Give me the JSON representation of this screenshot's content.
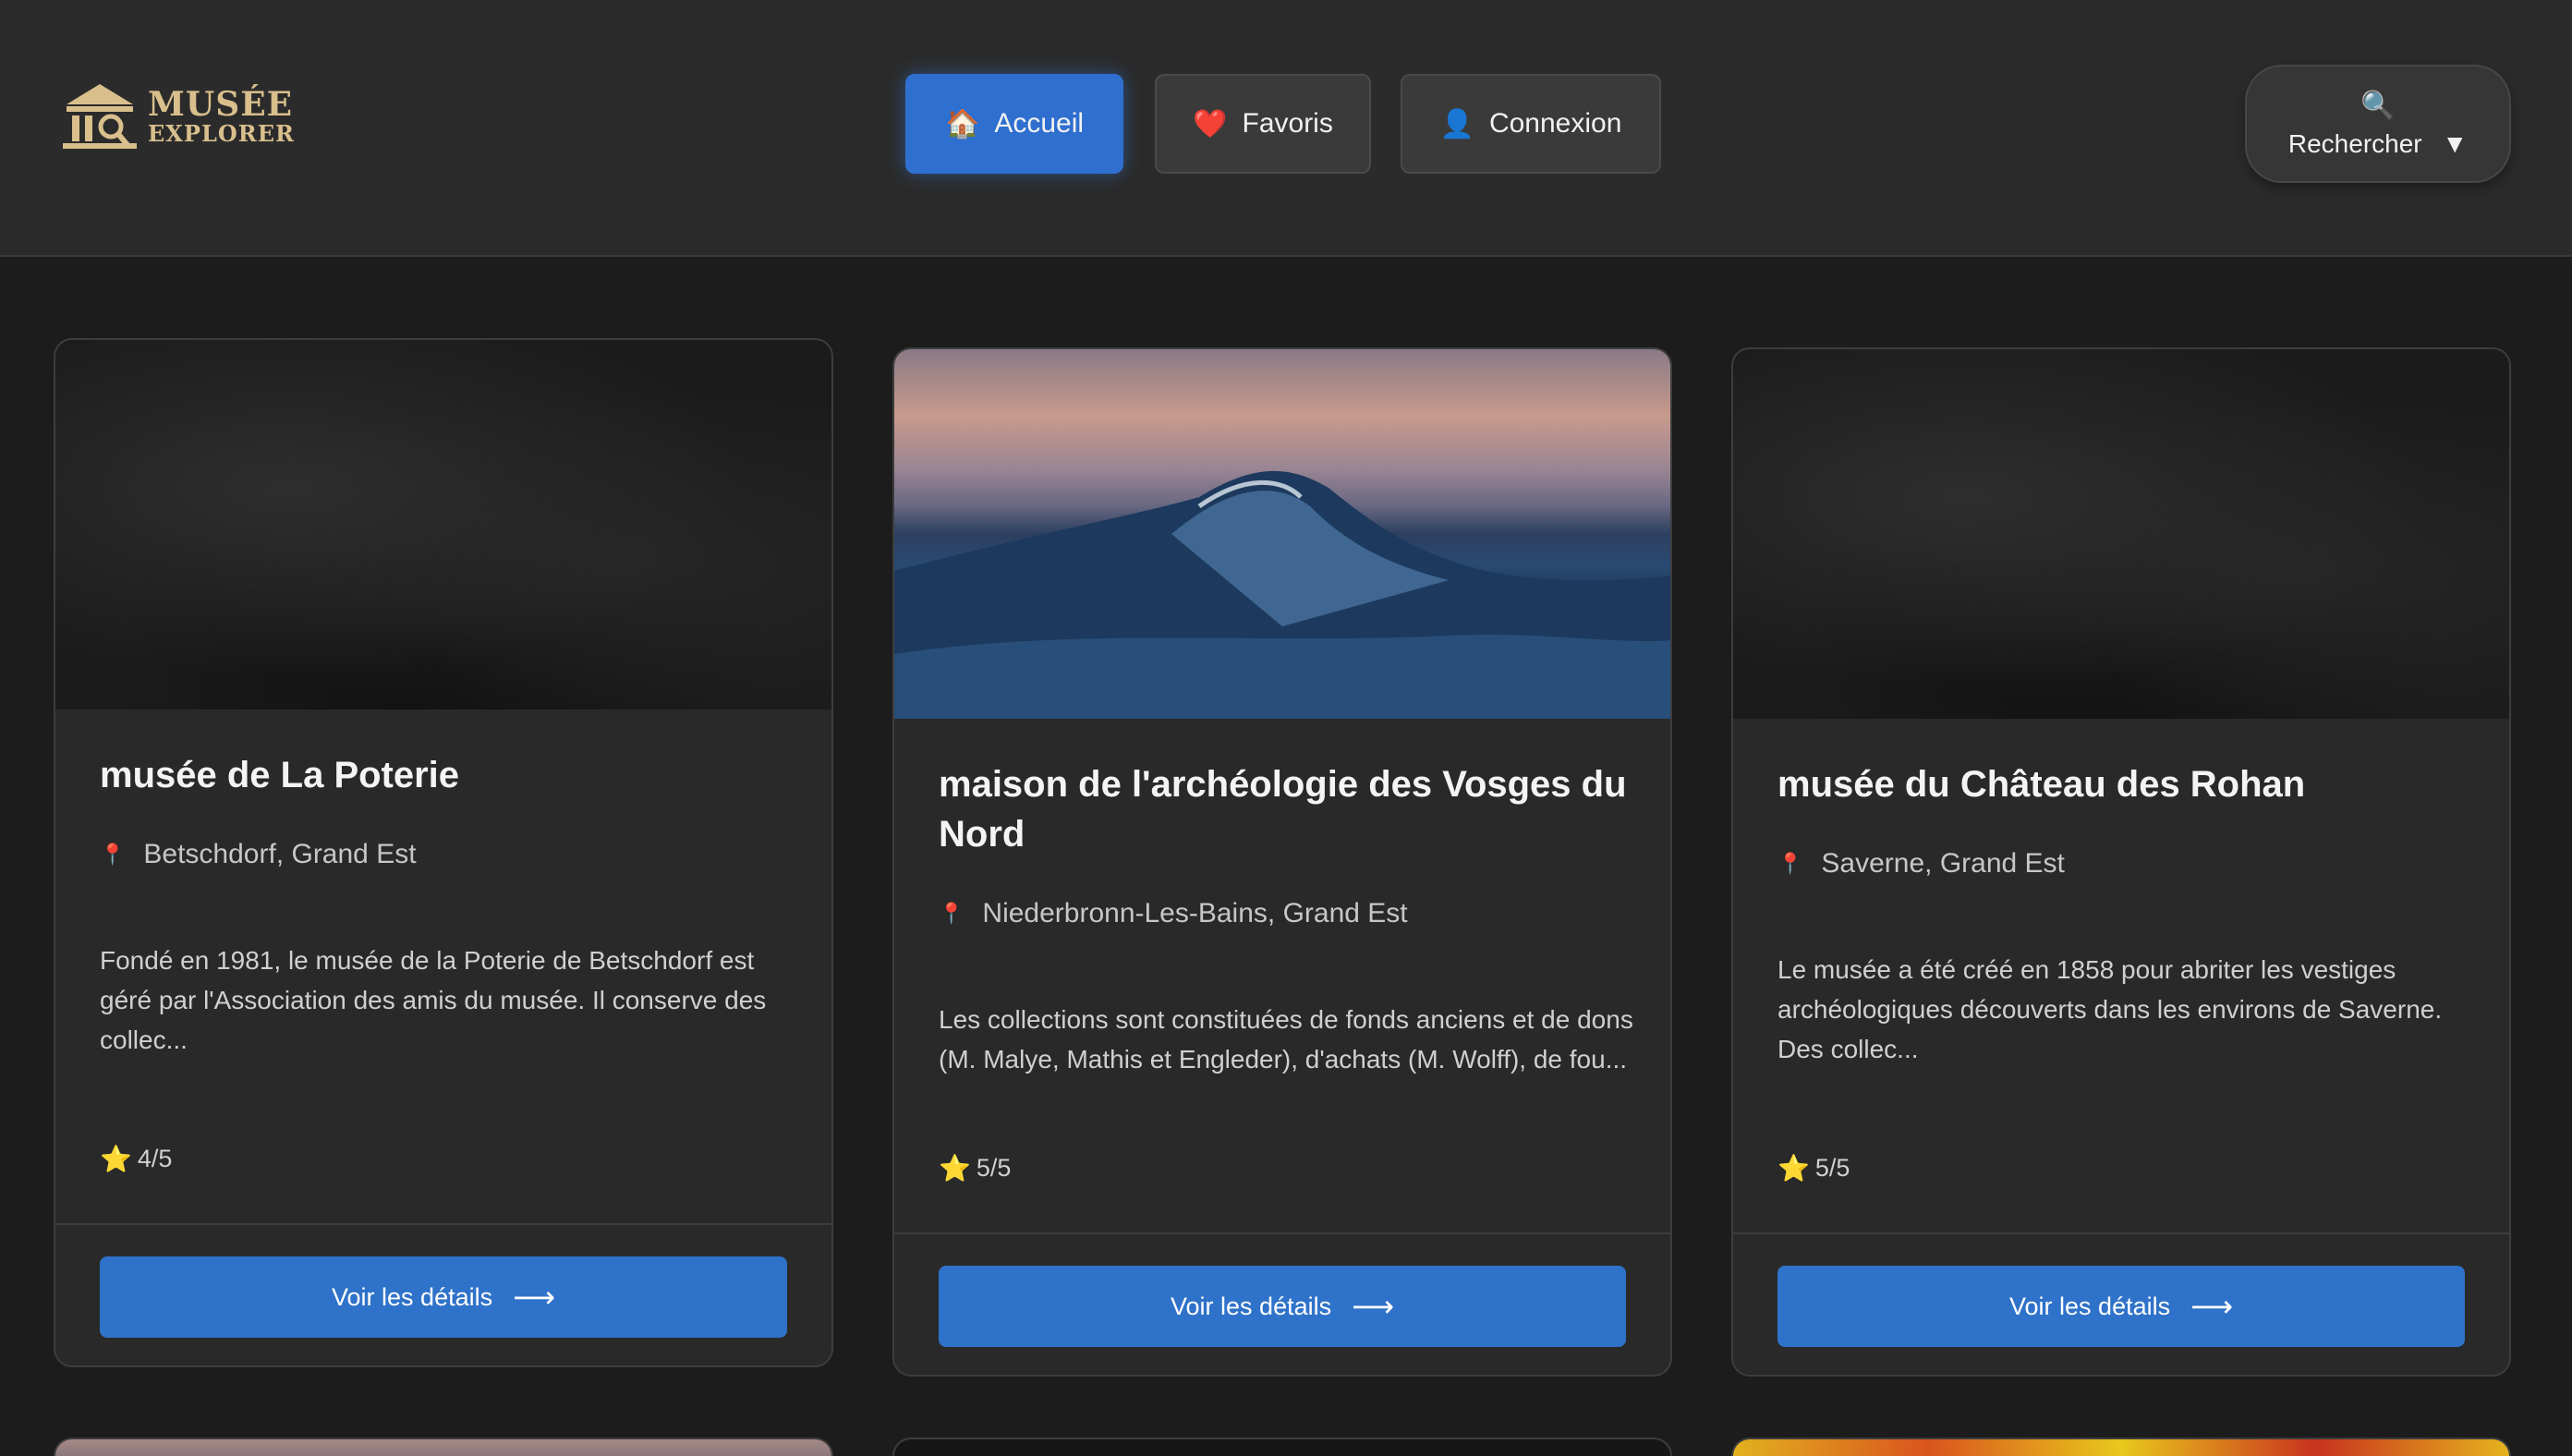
{
  "header": {
    "logo": {
      "line1": "MUSÉE",
      "line2": "EXPLORER"
    },
    "nav": [
      {
        "icon": "🏠",
        "label": "Accueil",
        "active": true
      },
      {
        "icon": "❤️",
        "label": "Favoris",
        "active": false
      },
      {
        "icon": "👤",
        "label": "Connexion",
        "active": false
      }
    ],
    "search": {
      "icon": "🔍",
      "label": "Rechercher",
      "caret": "▼"
    }
  },
  "cards": [
    {
      "title": "musée de La Poterie",
      "location": "Betschdorf, Grand Est",
      "description": "Fondé en 1981, le musée de la Poterie de Betschdorf est géré par l'Association des amis du musée. Il conserve des collec...",
      "rating": "4/5",
      "cta": "Voir les détails",
      "image": "dark-texture"
    },
    {
      "title": "maison de l'archéologie des Vosges du Nord",
      "location": "Niederbronn-Les-Bains, Grand Est",
      "description": "Les collections sont constituées de fonds anciens et de dons (M. Malye, Mathis et Engleder), d'achats (M. Wolff), de fou...",
      "rating": "5/5",
      "cta": "Voir les détails",
      "image": "ocean-wave"
    },
    {
      "title": "musée du Château des Rohan",
      "location": "Saverne, Grand Est",
      "description": "Le musée a été créé en 1858 pour abriter les vestiges archéologiques découverts dans les environs de Saverne. Des collec...",
      "rating": "5/5",
      "cta": "Voir les détails",
      "image": "dark-texture"
    }
  ],
  "icons": {
    "pin": "📍",
    "star": "⭐",
    "arrow": "⟶"
  },
  "colors": {
    "accent": "#2f72c9",
    "logo": "#d9bf8c",
    "background": "#1c1c1c",
    "card": "#292929"
  }
}
